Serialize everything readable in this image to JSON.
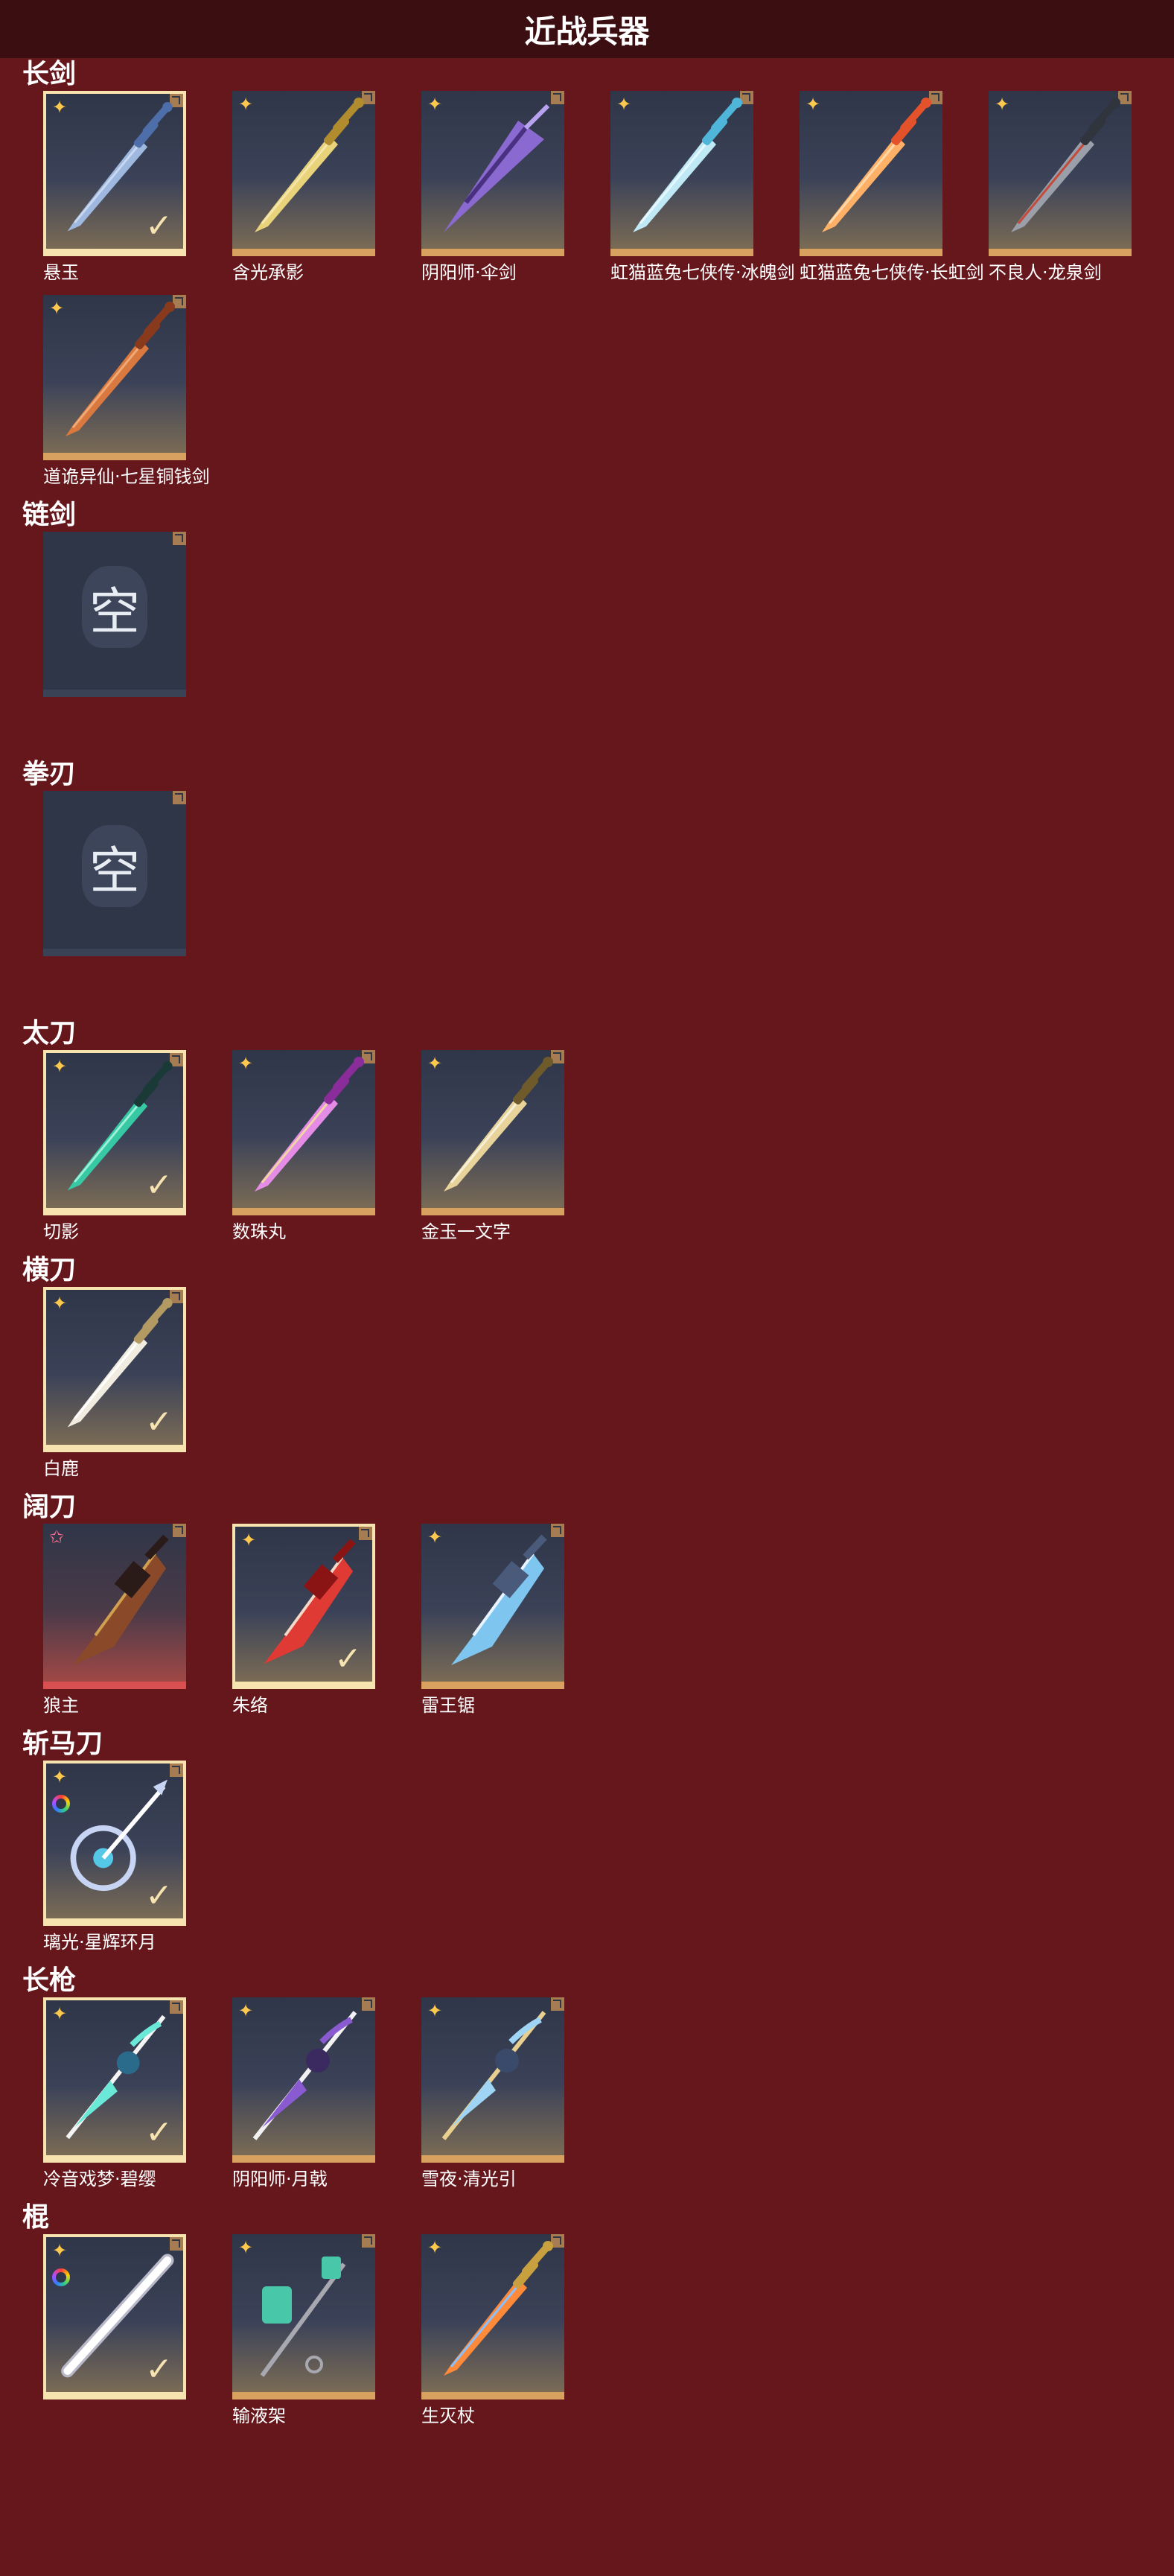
{
  "header": {
    "title": "近战兵器"
  },
  "empty_label": "空",
  "sections": [
    {
      "title": "长剑",
      "items": [
        {
          "name": "悬玉",
          "rarity": "star",
          "selected": true,
          "weapon": "sword-blue"
        },
        {
          "name": "含光承影",
          "rarity": "star",
          "selected": false,
          "weapon": "sword-gold"
        },
        {
          "name": "阴阳师·伞剑",
          "rarity": "star",
          "selected": false,
          "weapon": "umbrella-purple"
        },
        {
          "name": "虹猫蓝兔七侠传·冰魄剑",
          "rarity": "star",
          "selected": false,
          "weapon": "sword-ice"
        },
        {
          "name": "虹猫蓝兔七侠传·长虹剑",
          "rarity": "star",
          "selected": false,
          "weapon": "sword-fire"
        },
        {
          "name": "不良人·龙泉剑",
          "rarity": "star",
          "selected": false,
          "weapon": "sword-dark"
        },
        {
          "name": "道诡异仙·七星铜钱剑",
          "rarity": "star",
          "selected": false,
          "weapon": "coin-sword"
        }
      ]
    },
    {
      "title": "链剑",
      "items": [
        {
          "empty": true
        }
      ]
    },
    {
      "title": "拳刃",
      "items": [
        {
          "empty": true
        }
      ]
    },
    {
      "title": "太刀",
      "items": [
        {
          "name": "切影",
          "rarity": "star",
          "selected": true,
          "weapon": "katana-teal"
        },
        {
          "name": "数珠丸",
          "rarity": "star",
          "selected": false,
          "weapon": "katana-pink"
        },
        {
          "name": "金玉一文字",
          "rarity": "star",
          "selected": false,
          "weapon": "katana-gold"
        }
      ]
    },
    {
      "title": "横刀",
      "items": [
        {
          "name": "白鹿",
          "rarity": "star",
          "selected": true,
          "weapon": "saber-white"
        }
      ]
    },
    {
      "title": "阔刀",
      "items": [
        {
          "name": "狼主",
          "rarity": "star-pink",
          "selected": false,
          "red": true,
          "weapon": "broad-dark"
        },
        {
          "name": "朱络",
          "rarity": "star",
          "selected": true,
          "weapon": "broad-red"
        },
        {
          "name": "雷王锯",
          "rarity": "star",
          "selected": false,
          "weapon": "broad-lightning"
        }
      ]
    },
    {
      "title": "斩马刀",
      "items": [
        {
          "name": "璃光·星辉环月",
          "rarity": "star",
          "selected": true,
          "ring": true,
          "weapon": "moon-blade"
        }
      ]
    },
    {
      "title": "长枪",
      "items": [
        {
          "name": "冷音戏梦·碧缨",
          "rarity": "star",
          "selected": true,
          "weapon": "spear-teal"
        },
        {
          "name": "阴阳师·月戟",
          "rarity": "star",
          "selected": false,
          "weapon": "spear-purple"
        },
        {
          "name": "雪夜·清光引",
          "rarity": "star",
          "selected": false,
          "weapon": "spear-ice"
        }
      ]
    },
    {
      "title": "棍",
      "items": [
        {
          "name": "",
          "rarity": "star",
          "selected": true,
          "ring": true,
          "weapon": "staff-white"
        },
        {
          "name": "输液架",
          "rarity": "star",
          "selected": false,
          "weapon": "iv-stand"
        },
        {
          "name": "生灭杖",
          "rarity": "star",
          "selected": false,
          "weapon": "staff-fire"
        }
      ]
    }
  ],
  "colors": {
    "background": "#65171c",
    "header": "#3b0f12",
    "accent": "#d9a160",
    "selected": "#f6e3b0"
  }
}
